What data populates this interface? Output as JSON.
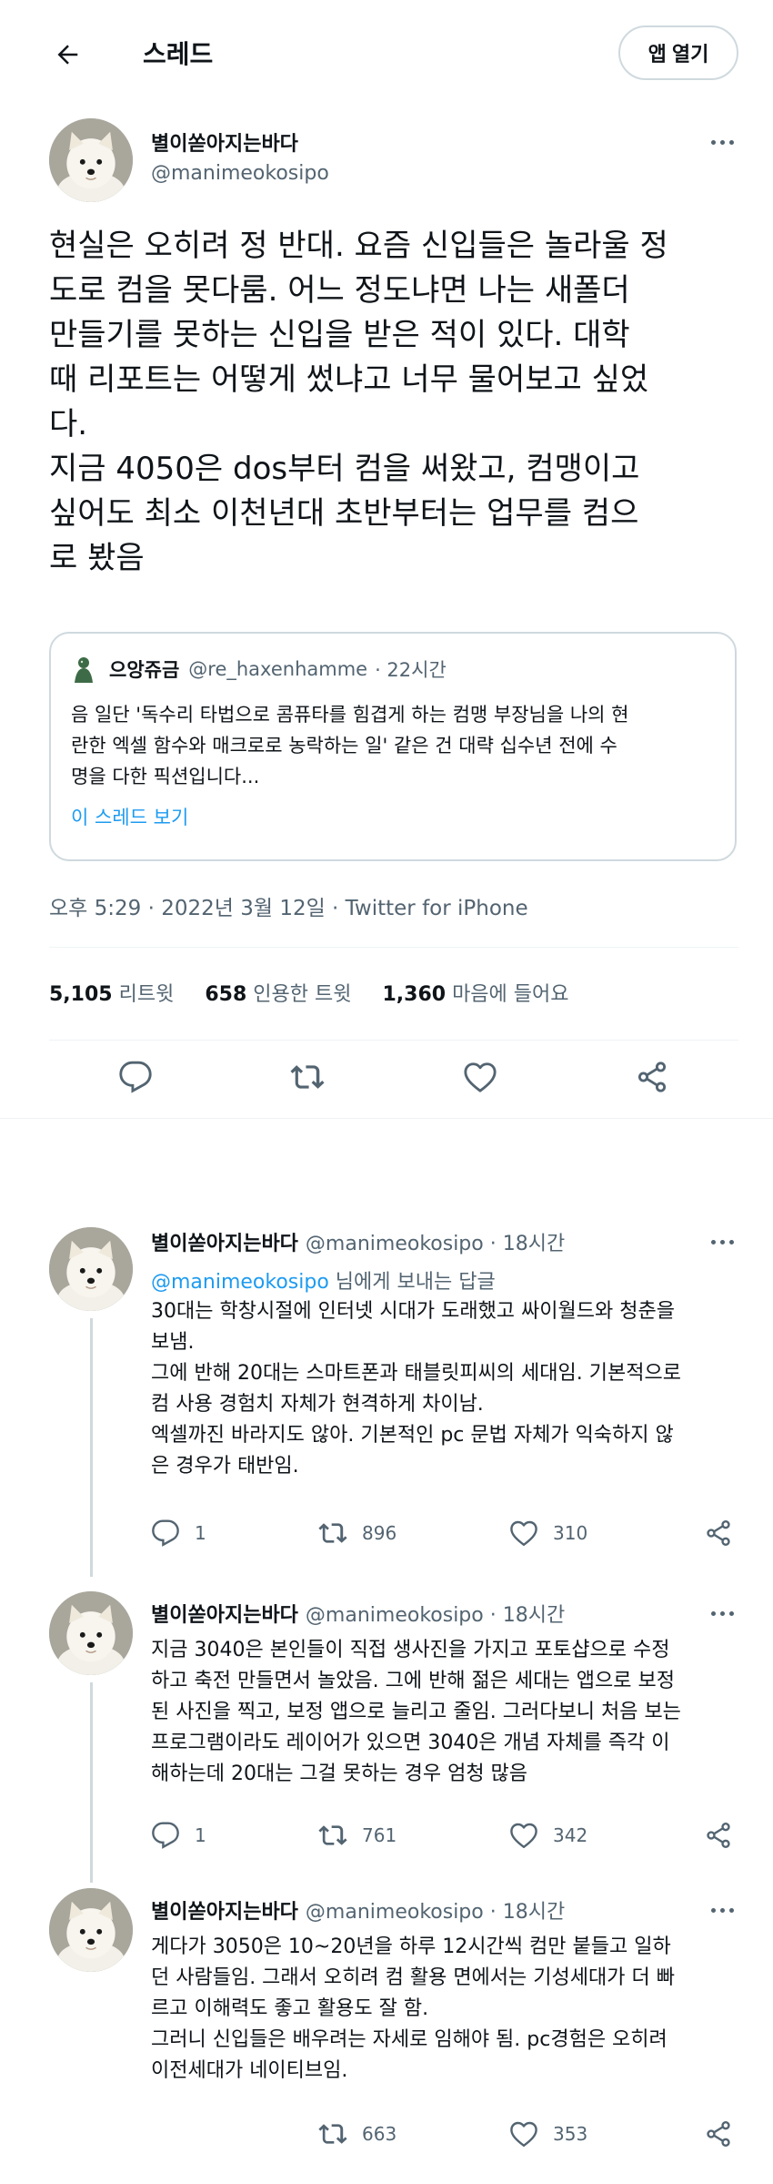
{
  "header": {
    "title": "스레드",
    "open_app_label": "앱 열기"
  },
  "main_tweet": {
    "name": "별이쏟아지는바다",
    "handle": "@manimeokosipo",
    "text": "현실은 오히려 정 반대. 요즘 신입들은 놀라울 정\n도로 컴을 못다룸. 어느 정도냐면 나는 새폴더\n만들기를 못하는 신입을 받은 적이 있다. 대학\n때 리포트는 어떻게 썼냐고 너무 물어보고 싶었\n다.\n지금 4050은 dos부터 컴을 써왔고, 컴맹이고\n싶어도 최소 이천년대 초반부터는 업무를 컴으\n로 봤음",
    "quote": {
      "name": "으앙쥬금",
      "handle": "@re_haxenhamme",
      "time": "· 22시간",
      "text": "음 일단 '독수리 타법으로 콤퓨타를 힘겹게 하는 컴맹 부장님을 나의 현\n란한 엑셀 함수와 매크로로 농락하는 일' 같은 건 대략 십수년 전에 수\n명을 다한 픽션입니다...",
      "link": "이 스레드 보기"
    },
    "meta": "오후 5:29 · 2022년 3월 12일 · Twitter for iPhone",
    "stats": {
      "retweets_count": "5,105",
      "retweets_label": "리트윗",
      "quotes_count": "658",
      "quotes_label": "인용한 트윗",
      "likes_count": "1,360",
      "likes_label": "마음에 들어요"
    }
  },
  "replies": [
    {
      "name": "별이쏟아지는바다",
      "handle": "@manimeokosipo · 18시간",
      "reply_to_mention": "@manimeokosipo",
      "reply_to_suffix": " 님에게 보내는 답글",
      "text": "30대는 학창시절에 인터넷 시대가 도래했고 싸이월드와 청춘을\n보냄.\n그에 반해 20대는 스마트폰과 태블릿피씨의 세대임. 기본적으로\n컴 사용 경험치 자체가 현격하게 차이남.\n엑셀까진 바라지도 않아. 기본적인 pc 문법 자체가 익숙하지 않\n은 경우가 태반임.",
      "replies": "1",
      "retweets": "896",
      "likes": "310"
    },
    {
      "name": "별이쏟아지는바다",
      "handle": "@manimeokosipo · 18시간",
      "text": "지금 3040은 본인들이 직접 생사진을 가지고 포토샵으로 수정\n하고 축전 만들면서 놀았음. 그에 반해 젊은 세대는 앱으로 보정\n된 사진을 찍고, 보정 앱으로 늘리고 줄임. 그러다보니 처음 보는\n프로그램이라도 레이어가 있으면 3040은 개념 자체를 즉각 이\n해하는데 20대는 그걸 못하는 경우 엄청 많음",
      "replies": "1",
      "retweets": "761",
      "likes": "342"
    },
    {
      "name": "별이쏟아지는바다",
      "handle": "@manimeokosipo · 18시간",
      "text": "게다가 3050은 10~20년을 하루 12시간씩 컴만 붙들고 일하\n던 사람들임. 그래서 오히려 컴 활용 면에서는 기성세대가 더 빠\n르고 이해력도 좋고 활용도 잘 함.\n그러니 신입들은 배우려는 자세로 임해야 됨. pc경험은 오히려\n이전세대가 네이티브임.",
      "retweets": "663",
      "likes": "353"
    }
  ],
  "icons": {
    "back": "back-arrow-icon",
    "more": "more-options-icon",
    "reply": "reply-icon",
    "retweet": "retweet-icon",
    "like": "heart-icon",
    "share": "share-icon"
  },
  "colors": {
    "text": "#0f1419",
    "secondary": "#536471",
    "link": "#1d9bf0",
    "border": "#cfd9de"
  }
}
